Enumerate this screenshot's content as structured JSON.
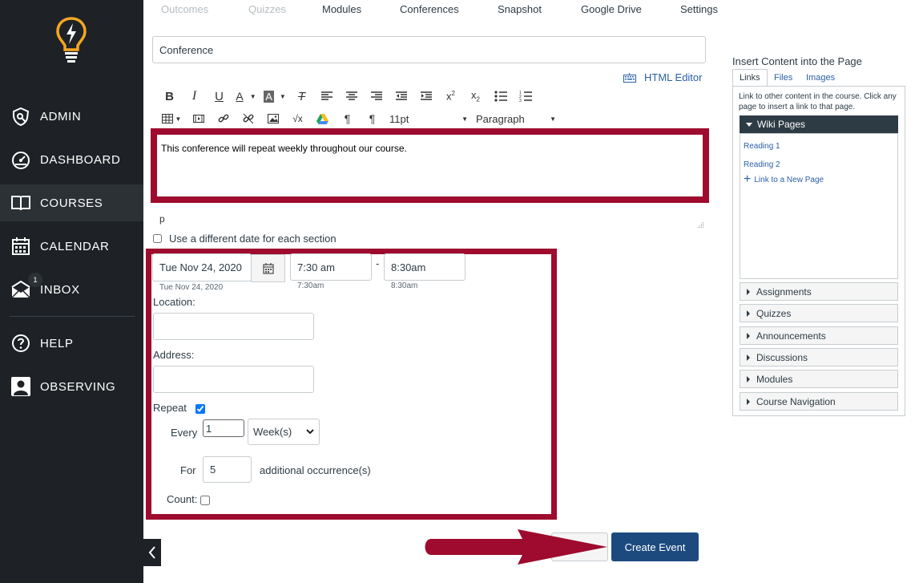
{
  "nav": {
    "items": [
      {
        "label": "ADMIN",
        "icon": "shield-icon"
      },
      {
        "label": "DASHBOARD",
        "icon": "dashboard-icon"
      },
      {
        "label": "COURSES",
        "icon": "book-icon"
      },
      {
        "label": "CALENDAR",
        "icon": "calendar-icon"
      },
      {
        "label": "INBOX",
        "icon": "inbox-icon",
        "badge": "1"
      },
      {
        "label": "HELP",
        "icon": "help-icon"
      },
      {
        "label": "OBSERVING",
        "icon": "observing-icon"
      }
    ]
  },
  "tabs": [
    "Outcomes",
    "Quizzes",
    "Modules",
    "Conferences",
    "Snapshot",
    "Google Drive",
    "Settings"
  ],
  "title_value": "Conference",
  "html_editor_label": "HTML Editor",
  "toolbar": {
    "font_size": "11pt",
    "block_format": "Paragraph"
  },
  "editor_text": "This conference will repeat weekly throughout our course.",
  "path_label": "p",
  "different_date_label": "Use a different date for each section",
  "date": {
    "value": "Tue Nov 24, 2020",
    "hint": "Tue Nov 24, 2020"
  },
  "start_time": {
    "value": "7:30 am",
    "hint": "7:30am"
  },
  "end_time": {
    "value": "8:30am",
    "hint": "8:30am"
  },
  "time_separator": "-",
  "location_label": "Location:",
  "address_label": "Address:",
  "repeat_label": "Repeat",
  "every_label": "Every",
  "every_value": "1",
  "frequency_value": "Week(s)",
  "for_label": "For",
  "for_value": "5",
  "additional_label": "additional occurrence(s)",
  "count_label": "Count:",
  "create_button": "Create Event",
  "right_panel": {
    "title": "Insert Content into the Page",
    "tabs": [
      "Links",
      "Files",
      "Images"
    ],
    "description": "Link to other content in the course. Click any page to insert a link to that page.",
    "wiki_header": "Wiki Pages",
    "wiki_links": [
      "Reading 1",
      "Reading 2"
    ],
    "new_page_link": "Link to a New Page",
    "sections": [
      "Assignments",
      "Quizzes",
      "Announcements",
      "Discussions",
      "Modules",
      "Course Navigation"
    ]
  },
  "colors": {
    "sidebar": "#1e2226",
    "highlight": "#9e0b2e",
    "primary": "#1c4a7e",
    "link": "#2b5fa8",
    "logo": "#f5a623"
  }
}
